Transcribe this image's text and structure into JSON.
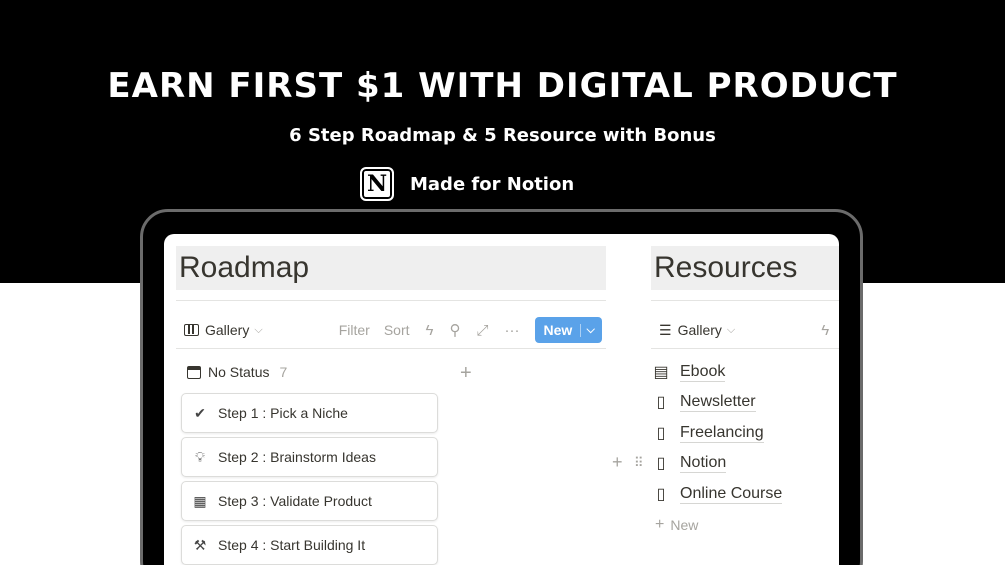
{
  "banner": {
    "headline": "EARN FIRST $1 WITH DIGITAL PRODUCT",
    "subheadline": "6 Step Roadmap & 5 Resource with Bonus",
    "made_for": "Made for Notion",
    "logo_letter": "N"
  },
  "roadmap": {
    "title": "Roadmap",
    "view_label": "Gallery",
    "toolbar": {
      "filter": "Filter",
      "sort": "Sort",
      "new_label": "New"
    },
    "group": {
      "label": "No Status",
      "count": "7"
    },
    "cards": [
      {
        "label": "Step 1 : Pick a Niche",
        "icon": "check-circle-icon"
      },
      {
        "label": "Step 2 : Brainstorm Ideas",
        "icon": "lightbulb-icon"
      },
      {
        "label": "Step 3 : Validate Product",
        "icon": "grid-icon"
      },
      {
        "label": "Step 4 : Start Building It",
        "icon": "hammer-icon"
      }
    ]
  },
  "resources": {
    "title": "Resources",
    "view_label": "Gallery",
    "items": [
      {
        "label": "Ebook",
        "icon": "ebook-icon"
      },
      {
        "label": "Newsletter",
        "icon": "book-icon"
      },
      {
        "label": "Freelancing",
        "icon": "book-icon"
      },
      {
        "label": "Notion",
        "icon": "book-icon"
      },
      {
        "label": "Online Course",
        "icon": "book-icon"
      }
    ],
    "new_label": "New"
  },
  "colors": {
    "banner_bg": "#000000",
    "accent_blue": "#2383e2",
    "text": "#37352f",
    "muted": "#a6a49f"
  }
}
